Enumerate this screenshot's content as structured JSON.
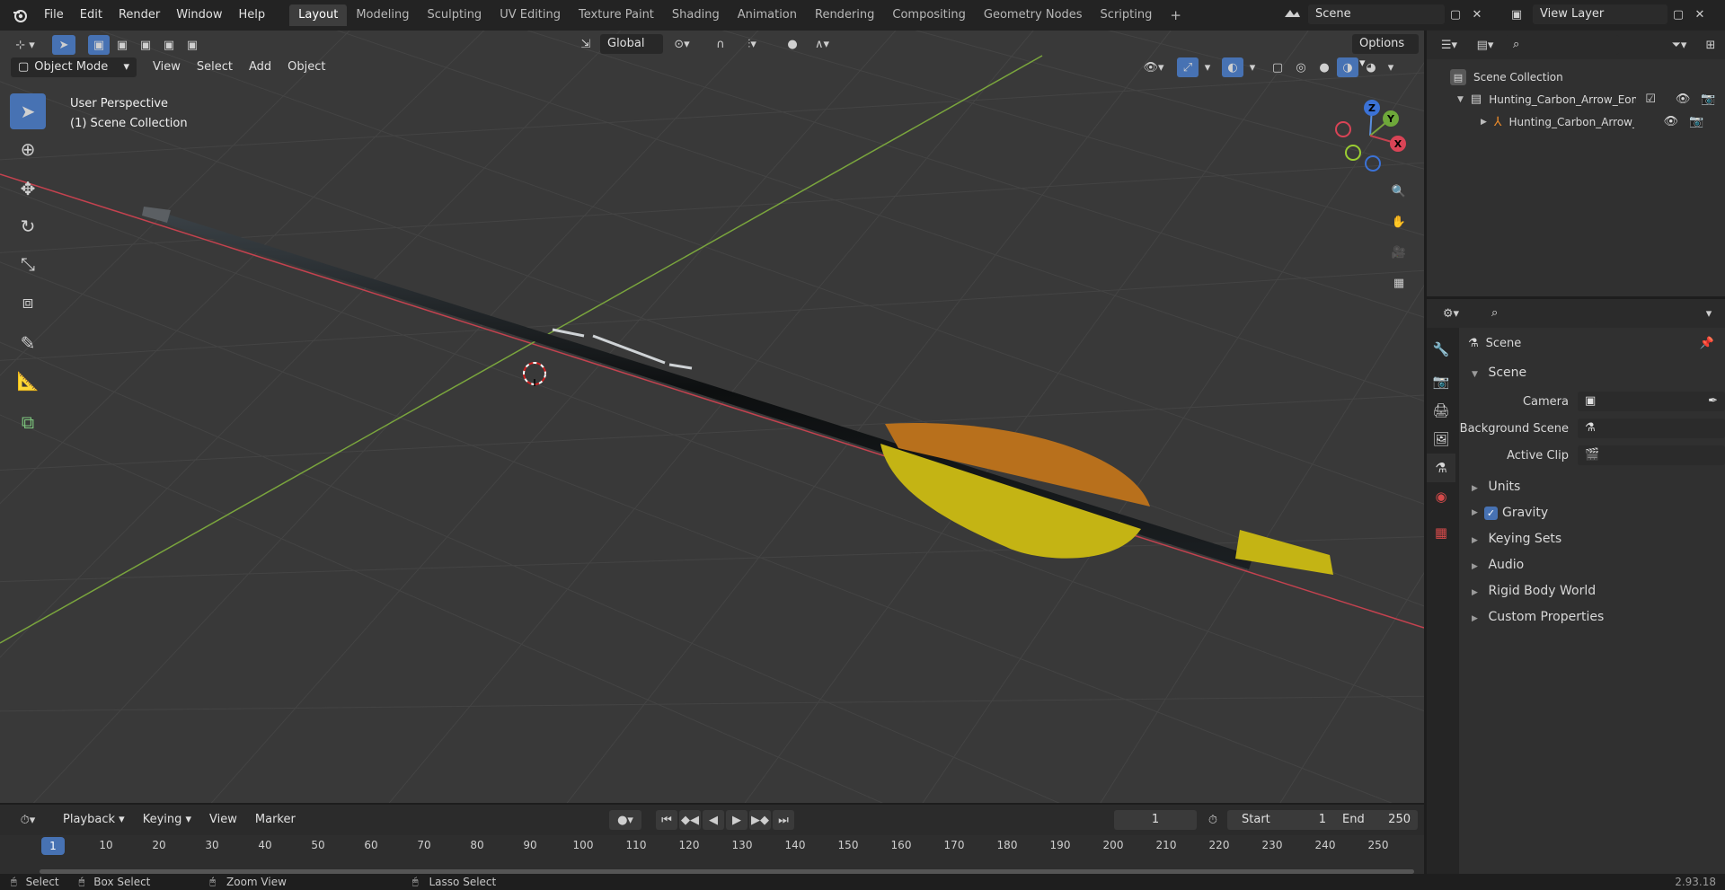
{
  "menu": [
    "File",
    "Edit",
    "Render",
    "Window",
    "Help"
  ],
  "workspaces": [
    "Layout",
    "Modeling",
    "Sculpting",
    "UV Editing",
    "Texture Paint",
    "Shading",
    "Animation",
    "Rendering",
    "Compositing",
    "Geometry Nodes",
    "Scripting"
  ],
  "active_workspace": "Layout",
  "scene_name": "Scene",
  "view_layer": "View Layer",
  "viewport_header": {
    "mode": "Object Mode",
    "menus": [
      "View",
      "Select",
      "Add",
      "Object"
    ],
    "transform_orientation": "Global",
    "options_label": "Options"
  },
  "viewport": {
    "perspective_label": "User Perspective",
    "collection_label": "(1) Scene Collection",
    "gizmo_axes": {
      "x": "X",
      "y": "Y",
      "z": "Z"
    }
  },
  "outliner": {
    "root": "Scene Collection",
    "items": [
      {
        "label": "Hunting_Carbon_Arrow_Eome",
        "depth": 1
      },
      {
        "label": "Hunting_Carbon_Arrow_E",
        "depth": 2
      }
    ]
  },
  "properties": {
    "header": "Scene",
    "section_title": "Scene",
    "fields": [
      {
        "label": "Camera"
      },
      {
        "label": "Background Scene"
      },
      {
        "label": "Active Clip"
      }
    ],
    "subsections": [
      "Units",
      "Gravity",
      "Keying Sets",
      "Audio",
      "Rigid Body World",
      "Custom Properties"
    ],
    "gravity_checked": true
  },
  "timeline": {
    "menus": [
      "Playback",
      "Keying",
      "View",
      "Marker"
    ],
    "current_frame": "1",
    "start_label": "Start",
    "start_value": "1",
    "end_label": "End",
    "end_value": "250",
    "ruler": [
      "1",
      "10",
      "20",
      "30",
      "40",
      "50",
      "60",
      "70",
      "80",
      "90",
      "100",
      "110",
      "120",
      "130",
      "140",
      "150",
      "160",
      "170",
      "180",
      "190",
      "200",
      "210",
      "220",
      "230",
      "240",
      "250"
    ]
  },
  "statusbar": {
    "items": [
      "Select",
      "Box Select",
      "Zoom View",
      "Lasso Select"
    ],
    "version": "2.93.18"
  },
  "colors": {
    "accent": "#4772b3",
    "x_axis": "#c4424f",
    "y_axis": "#7aa53d",
    "fletch_orange": "#b8701c",
    "fletch_yellow": "#c4b414"
  }
}
